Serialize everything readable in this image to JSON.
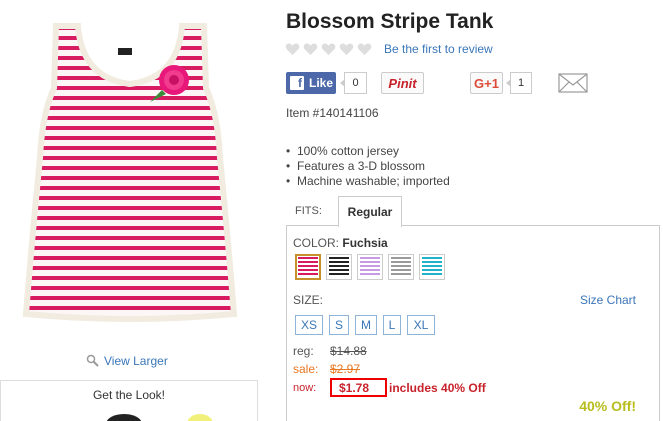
{
  "product": {
    "title": "Blossom Stripe Tank",
    "review_link": "Be the first to review",
    "rating_hearts": 5,
    "item_number": "Item #140141106",
    "features": [
      "100% cotton jersey",
      "Features a 3-D blossom",
      "Machine washable; imported"
    ],
    "view_larger": "View Larger",
    "get_the_look": "Get the Look!"
  },
  "social": {
    "like_label": "Like",
    "like_count": "0",
    "pin_label": "Pinit",
    "gplus_label": "G+1",
    "gplus_count": "1"
  },
  "fits": {
    "label": "FITS:",
    "tabs": [
      {
        "label": "Regular",
        "selected": true
      }
    ]
  },
  "color": {
    "label": "COLOR:",
    "selected": "Fuchsia",
    "swatches": [
      {
        "name": "Fuchsia",
        "stripe": "#d81b60",
        "selected": true
      },
      {
        "name": "Black",
        "stripe": "#222222",
        "selected": false
      },
      {
        "name": "Lavender",
        "stripe": "#c79be3",
        "selected": false
      },
      {
        "name": "Grey",
        "stripe": "#9a9a9a",
        "selected": false
      },
      {
        "name": "Aqua",
        "stripe": "#1fb4c9",
        "selected": false
      }
    ]
  },
  "size": {
    "label": "SIZE:",
    "chart_link": "Size Chart",
    "options": [
      "XS",
      "S",
      "M",
      "L",
      "XL"
    ]
  },
  "pricing": {
    "reg_label": "reg:",
    "reg_price": "$14.88",
    "sale_label": "sale:",
    "sale_price": "$2.97",
    "now_label": "now:",
    "now_price": "$1.78",
    "now_note": "includes 40% Off",
    "badge": "40% Off!"
  },
  "colors": {
    "link": "#3b76b8",
    "price_red": "#c8232c",
    "sale_orange": "#e87722",
    "badge_olive": "#b8bd1c",
    "facebook": "#4c68a8"
  }
}
